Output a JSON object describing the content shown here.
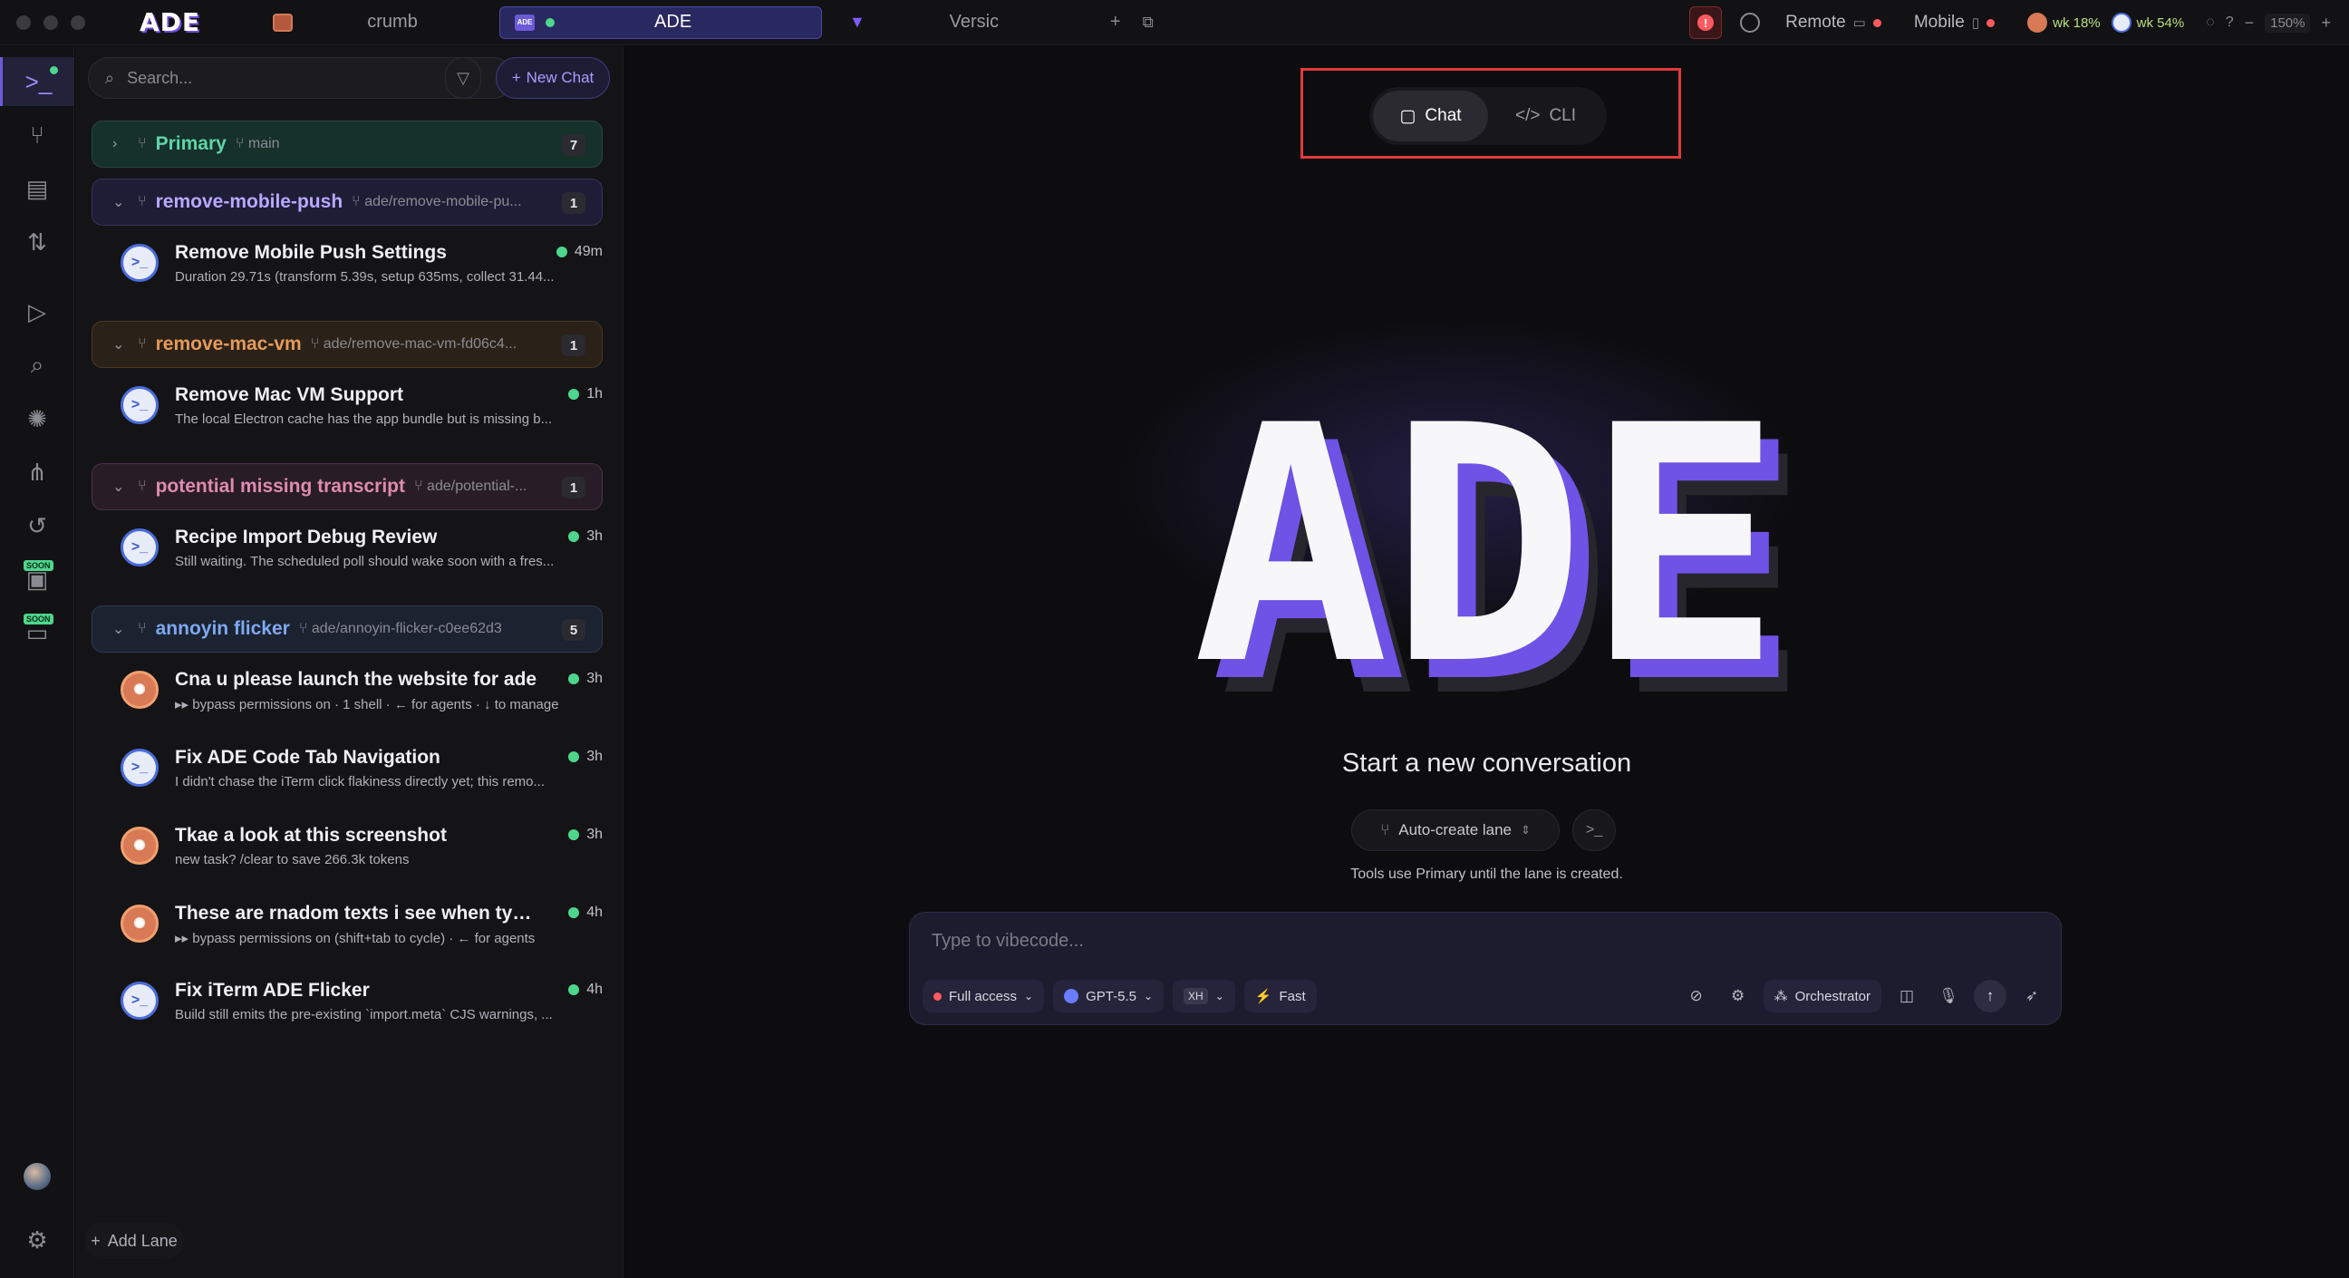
{
  "titlebar": {
    "app_logo": "ADE",
    "tabs": [
      {
        "label": "crumb"
      },
      {
        "label": "ADE",
        "badge": "ADE"
      },
      {
        "label": "Versic"
      }
    ],
    "remote_label": "Remote",
    "mobile_label": "Mobile",
    "meter1": "wk 18%",
    "meter2": "wk 54%",
    "zoom": "150%"
  },
  "rail": {
    "items": [
      "terminal-icon",
      "branch-icon",
      "file-code-icon",
      "pull-request-icon",
      "play-icon",
      "search-icon",
      "brain-icon",
      "graph-icon",
      "history-icon",
      "soon-app-icon",
      "soon-device-icon"
    ],
    "soon_label": "SOON"
  },
  "sidebar": {
    "search_placeholder": "Search...",
    "new_chat_label": "New Chat",
    "add_lane_label": "Add Lane",
    "lanes": [
      {
        "name": "Primary",
        "ref": "main",
        "count": "7"
      },
      {
        "name": "remove-mobile-push",
        "ref": "ade/remove-mobile-pu...",
        "count": "1"
      },
      {
        "name": "remove-mac-vm",
        "ref": "ade/remove-mac-vm-fd06c4...",
        "count": "1"
      },
      {
        "name": "potential missing transcript",
        "ref": "ade/potential-...",
        "count": "1"
      },
      {
        "name": "annoyin flicker",
        "ref": "ade/annoyin-flicker-c0ee62d3",
        "count": "5"
      }
    ],
    "chats": [
      {
        "title": "Remove Mobile Push Settings",
        "sub": "Duration 29.71s (transform 5.39s, setup 635ms, collect 31.44...",
        "time": "49m"
      },
      {
        "title": "Remove Mac VM Support",
        "sub": "The local Electron cache has the app bundle but is missing b...",
        "time": "1h"
      },
      {
        "title": "Recipe Import Debug Review",
        "sub": "Still waiting. The scheduled poll should wake soon with a fres...",
        "time": "3h"
      },
      {
        "title": "Cna u please launch the website for ade",
        "sub": "▸▸ bypass permissions on · 1 shell · ← for agents · ↓ to manage",
        "time": "3h"
      },
      {
        "title": "Fix ADE Code Tab Navigation",
        "sub": "I didn't chase the iTerm click flakiness directly yet; this remo...",
        "time": "3h"
      },
      {
        "title": "Tkae a look at this screenshot",
        "sub": "new task? /clear to save 266.3k tokens",
        "time": "3h"
      },
      {
        "title": "These are rnadom texts i see when typi...",
        "sub": "▸▸ bypass permissions on (shift+tab to cycle) · ← for agents",
        "time": "4h"
      },
      {
        "title": "Fix iTerm ADE Flicker",
        "sub": "Build still emits the pre-existing `import.meta` CJS warnings, ...",
        "time": "4h"
      }
    ]
  },
  "main": {
    "toggle": {
      "chat": "Chat",
      "cli": "CLI"
    },
    "hero_logo": "ADE",
    "start_text": "Start a new conversation",
    "auto_lane": "Auto-create lane",
    "tools_note": "Tools use Primary until the lane is created.",
    "composer": {
      "placeholder": "Type to vibecode...",
      "access": "Full access",
      "model": "GPT-5.5",
      "effort": "XH",
      "speed": "Fast",
      "mode": "Orchestrator"
    }
  },
  "colors": {
    "accent": "#6b5ad8",
    "green": "#4dd68c",
    "red": "#ff5a5f"
  }
}
